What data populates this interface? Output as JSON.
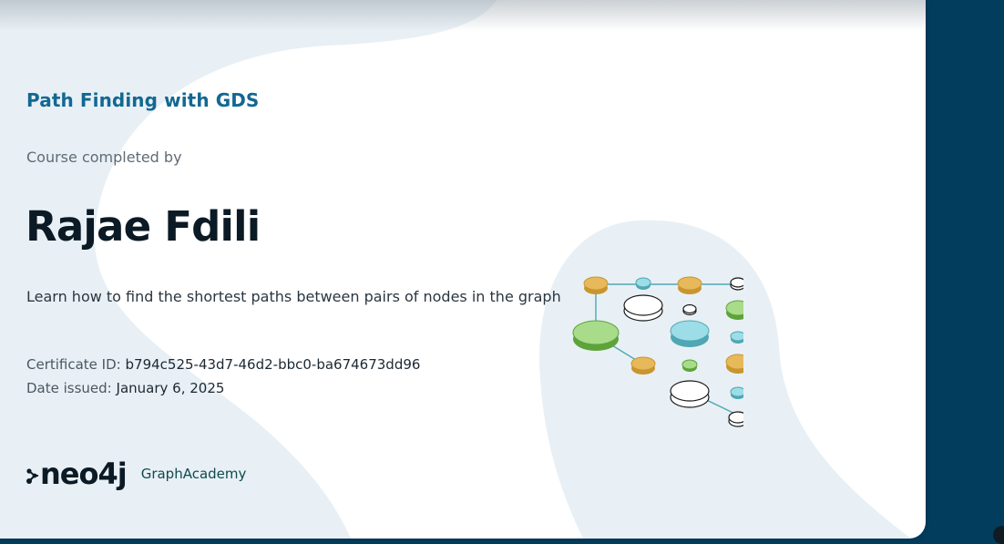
{
  "course": {
    "title": "Path Finding with GDS"
  },
  "completed_by_label": "Course completed by",
  "recipient_name": "Rajae Fdili",
  "description": "Learn how to find the shortest paths between pairs of nodes in the graph",
  "certificate": {
    "id_label": "Certificate ID:",
    "id_value": "b794c525-43d7-46d2-bbc0-ba674673dd96",
    "date_label": "Date issued:",
    "date_value": "January 6, 2025"
  },
  "brand": {
    "logo_text": "neo4j",
    "product": "GraphAcademy"
  },
  "colors": {
    "page_background": "#033d5e",
    "title": "#126893",
    "blob": "#e8f0f5",
    "node_orange": "#e8b95a",
    "node_green": "#8fcf63",
    "node_blue": "#9cdde8",
    "edge": "#4fa7b3"
  },
  "icons": [
    "neo4j-logo-icon",
    "graph-network-icon"
  ]
}
